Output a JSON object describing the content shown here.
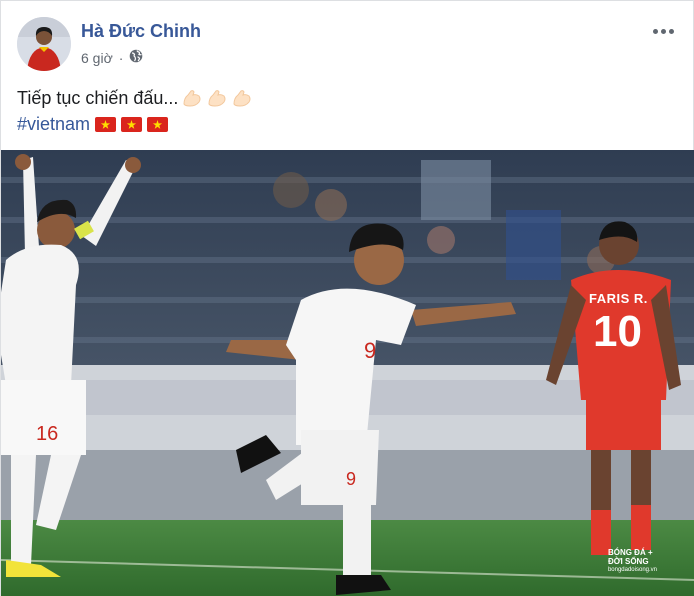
{
  "post": {
    "author": "Hà Đức Chinh",
    "time": "6 giờ",
    "privacy_icon": "globe-icon",
    "more_icon": "more-options-icon",
    "text_line1": "Tiếp tục chiến đấu...",
    "hashtag": "#vietnam",
    "emojis_line1": [
      "flexed-biceps",
      "flexed-biceps",
      "flexed-biceps"
    ],
    "emojis_line2": [
      "vietnam-flag",
      "vietnam-flag",
      "vietnam-flag"
    ]
  },
  "photo": {
    "jersey_name": "FARIS R.",
    "jersey_number": "10",
    "watermark_title": "BÓNG ĐÁ +",
    "watermark_subtitle": "ĐỜI SỐNG",
    "watermark_site": "bongdadoisong.vn"
  },
  "colors": {
    "author": "#385898",
    "hashtag": "#365899",
    "meta": "#606770",
    "vietnam_kit": "#f5f5f5",
    "opponent_kit": "#e0392c",
    "pitch": "#3f7a3a"
  }
}
